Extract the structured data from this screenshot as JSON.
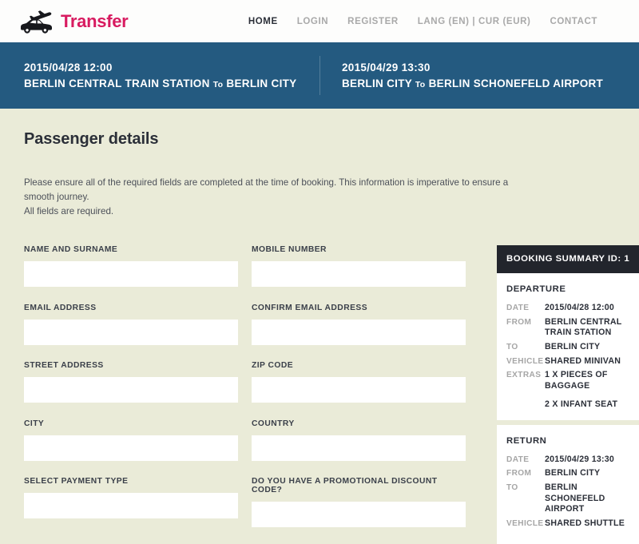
{
  "header": {
    "logo_text": "Transfer",
    "logo_icons": [
      "airplane-icon",
      "car-icon"
    ],
    "brand_color": "#d81b60",
    "nav": [
      {
        "label": "HOME",
        "active": true
      },
      {
        "label": "LOGIN",
        "active": false
      },
      {
        "label": "REGISTER",
        "active": false
      },
      {
        "label": "LANG (EN) | CUR (EUR)",
        "active": false
      },
      {
        "label": "CONTACT",
        "active": false
      }
    ]
  },
  "trip_banner": {
    "background_color": "#245a80",
    "outbound": {
      "datetime": "2015/04/28 12:00",
      "from": "BERLIN CENTRAL TRAIN STATION",
      "to_word": "To",
      "to": "BERLIN CITY"
    },
    "return": {
      "datetime": "2015/04/29 13:30",
      "from": "BERLIN CITY",
      "to_word": "To",
      "to": "BERLIN SCHONEFELD AIRPORT"
    }
  },
  "main": {
    "title": "Passenger details",
    "intro_line1": "Please ensure all of the required fields are completed at the time of booking. This information is imperative to ensure a smooth journey.",
    "intro_line2": "All fields are required.",
    "fields": [
      {
        "label": "NAME AND SURNAME",
        "value": "",
        "placeholder": "",
        "type": "text"
      },
      {
        "label": "MOBILE NUMBER",
        "value": "",
        "placeholder": "",
        "type": "text"
      },
      {
        "label": "EMAIL ADDRESS",
        "value": "",
        "placeholder": "",
        "type": "text"
      },
      {
        "label": "CONFIRM EMAIL ADDRESS",
        "value": "",
        "placeholder": "",
        "type": "text"
      },
      {
        "label": "STREET ADDRESS",
        "value": "",
        "placeholder": "",
        "type": "text"
      },
      {
        "label": "ZIP CODE",
        "value": "",
        "placeholder": "",
        "type": "text"
      },
      {
        "label": "CITY",
        "value": "",
        "placeholder": "",
        "type": "text"
      },
      {
        "label": "COUNTRY",
        "value": "",
        "placeholder": "",
        "type": "text"
      },
      {
        "label": "SELECT PAYMENT TYPE",
        "value": "",
        "placeholder": "",
        "type": "select"
      },
      {
        "label": "DO YOU HAVE A PROMOTIONAL DISCOUNT CODE?",
        "value": "",
        "placeholder": "",
        "type": "text"
      }
    ]
  },
  "summary": {
    "header_label": "BOOKING SUMMARY ID: 1",
    "header_bg": "#22252c",
    "departure": {
      "section_title": "DEPARTURE",
      "rows": [
        {
          "key": "DATE",
          "value": "2015/04/28 12:00"
        },
        {
          "key": "FROM",
          "value": "BERLIN CENTRAL TRAIN STATION"
        },
        {
          "key": "TO",
          "value": "BERLIN CITY"
        },
        {
          "key": "VEHICLE",
          "value": "SHARED MINIVAN"
        },
        {
          "key": "EXTRAS",
          "value": "1 X PIECES OF BAGGAGE"
        }
      ],
      "extra_second": "2 X INFANT SEAT"
    },
    "return": {
      "section_title": "RETURN",
      "rows": [
        {
          "key": "DATE",
          "value": "2015/04/29 13:30"
        },
        {
          "key": "FROM",
          "value": "BERLIN CITY"
        },
        {
          "key": "TO",
          "value": "BERLIN SCHONEFELD AIRPORT"
        },
        {
          "key": "VEHICLE",
          "value": "SHARED SHUTTLE"
        }
      ]
    }
  }
}
